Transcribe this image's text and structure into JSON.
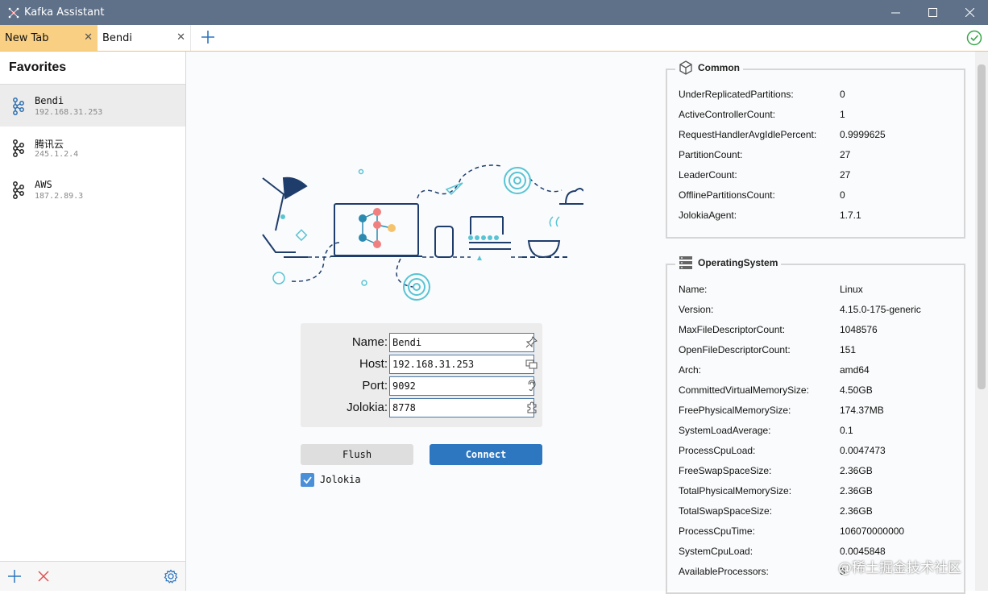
{
  "window": {
    "title": "Kafka Assistant"
  },
  "tabs": [
    {
      "label": "New Tab",
      "active": true
    },
    {
      "label": "Bendi",
      "active": false
    }
  ],
  "sidebar": {
    "title": "Favorites",
    "items": [
      {
        "name": "Bendi",
        "host": "192.168.31.253"
      },
      {
        "name": "腾讯云",
        "host": "245.1.2.4"
      },
      {
        "name": "AWS",
        "host": "187.2.89.3"
      }
    ]
  },
  "form": {
    "name_label": "Name:",
    "name_value": "Bendi",
    "host_label": "Host:",
    "host_value": "192.168.31.253",
    "port_label": "Port:",
    "port_value": "9092",
    "jolokia_label": "Jolokia:",
    "jolokia_value": "8778"
  },
  "buttons": {
    "flush": "Flush",
    "connect": "Connect"
  },
  "jolokia_checkbox": {
    "label": "Jolokia",
    "checked": true
  },
  "common": {
    "title": "Common",
    "rows": [
      {
        "k": "UnderReplicatedPartitions:",
        "v": "0"
      },
      {
        "k": "ActiveControllerCount:",
        "v": "1"
      },
      {
        "k": "RequestHandlerAvgIdlePercent:",
        "v": "0.9999625"
      },
      {
        "k": "PartitionCount:",
        "v": "27"
      },
      {
        "k": "LeaderCount:",
        "v": "27"
      },
      {
        "k": "OfflinePartitionsCount:",
        "v": "0"
      },
      {
        "k": "JolokiaAgent:",
        "v": "1.7.1"
      }
    ]
  },
  "os": {
    "title": "OperatingSystem",
    "rows": [
      {
        "k": "Name:",
        "v": "Linux"
      },
      {
        "k": "Version:",
        "v": "4.15.0-175-generic"
      },
      {
        "k": "MaxFileDescriptorCount:",
        "v": "1048576"
      },
      {
        "k": "OpenFileDescriptorCount:",
        "v": "151"
      },
      {
        "k": "Arch:",
        "v": "amd64"
      },
      {
        "k": "CommittedVirtualMemorySize:",
        "v": "4.50GB"
      },
      {
        "k": "FreePhysicalMemorySize:",
        "v": "174.37MB"
      },
      {
        "k": "SystemLoadAverage:",
        "v": "0.1"
      },
      {
        "k": "ProcessCpuLoad:",
        "v": "0.0047473"
      },
      {
        "k": "FreeSwapSpaceSize:",
        "v": "2.36GB"
      },
      {
        "k": "TotalPhysicalMemorySize:",
        "v": "2.36GB"
      },
      {
        "k": "TotalSwapSpaceSize:",
        "v": "2.36GB"
      },
      {
        "k": "ProcessCpuTime:",
        "v": "106070000000"
      },
      {
        "k": "SystemCpuLoad:",
        "v": "0.0045848"
      },
      {
        "k": "AvailableProcessors:",
        "v": "3"
      }
    ]
  },
  "watermark": "@稀土掘金技术社区",
  "colors": {
    "titlebar": "#5f7189",
    "active_tab": "#f8cf83",
    "accent": "#2d76c0"
  }
}
